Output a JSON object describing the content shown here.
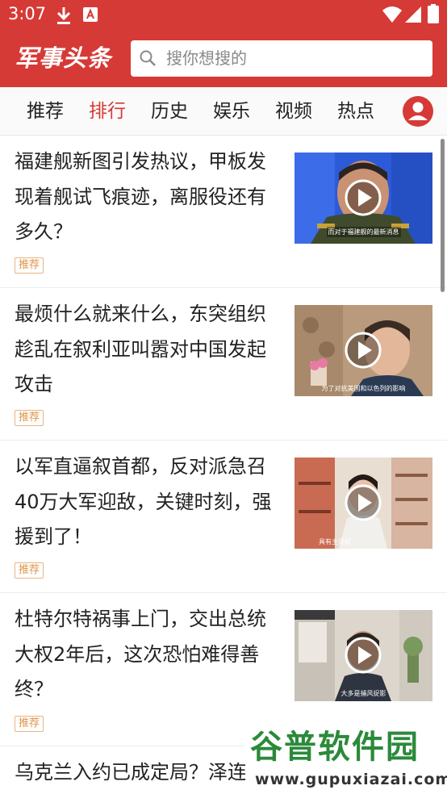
{
  "status_bar": {
    "time": "3:07",
    "icons": [
      "download-icon",
      "a-letter-icon",
      "wifi-icon",
      "signal-icon",
      "battery-icon"
    ]
  },
  "header": {
    "logo_text": "军事头条",
    "search_placeholder": "搜你想搜的",
    "accent_color": "#d63a36"
  },
  "tabs": [
    {
      "label": "推荐",
      "active": false
    },
    {
      "label": "排行",
      "active": true
    },
    {
      "label": "历史",
      "active": false
    },
    {
      "label": "娱乐",
      "active": false
    },
    {
      "label": "视频",
      "active": false
    },
    {
      "label": "热点",
      "active": false
    }
  ],
  "feed": [
    {
      "title": "福建舰新图引发热议，甲板发现着舰试飞痕迹，离服役还有多久？",
      "badge": "推荐",
      "thumb_caption": "而对于福建舰的最新消息"
    },
    {
      "title": "最烦什么就来什么，东突组织趁乱在叙利亚叫嚣对中国发起攻击",
      "badge": "推荐",
      "thumb_caption": "为了对抗美国和以色列的影响"
    },
    {
      "title": "以军直逼叙首都，反对派急召40万大军迎敌，关键时刻，强援到了！",
      "badge": "推荐",
      "thumb_caption": "具有主导权"
    },
    {
      "title": "杜特尔特祸事上门，交出总统大权2年后，这次恐怕难得善终？",
      "badge": "推荐",
      "thumb_caption": "大多是捕风捉影"
    },
    {
      "title": "乌克兰入约已成定局？泽连",
      "badge": "",
      "thumb_caption": ""
    }
  ],
  "watermark": {
    "name": "谷普软件园",
    "url": "www.gupuxiazai.com"
  }
}
